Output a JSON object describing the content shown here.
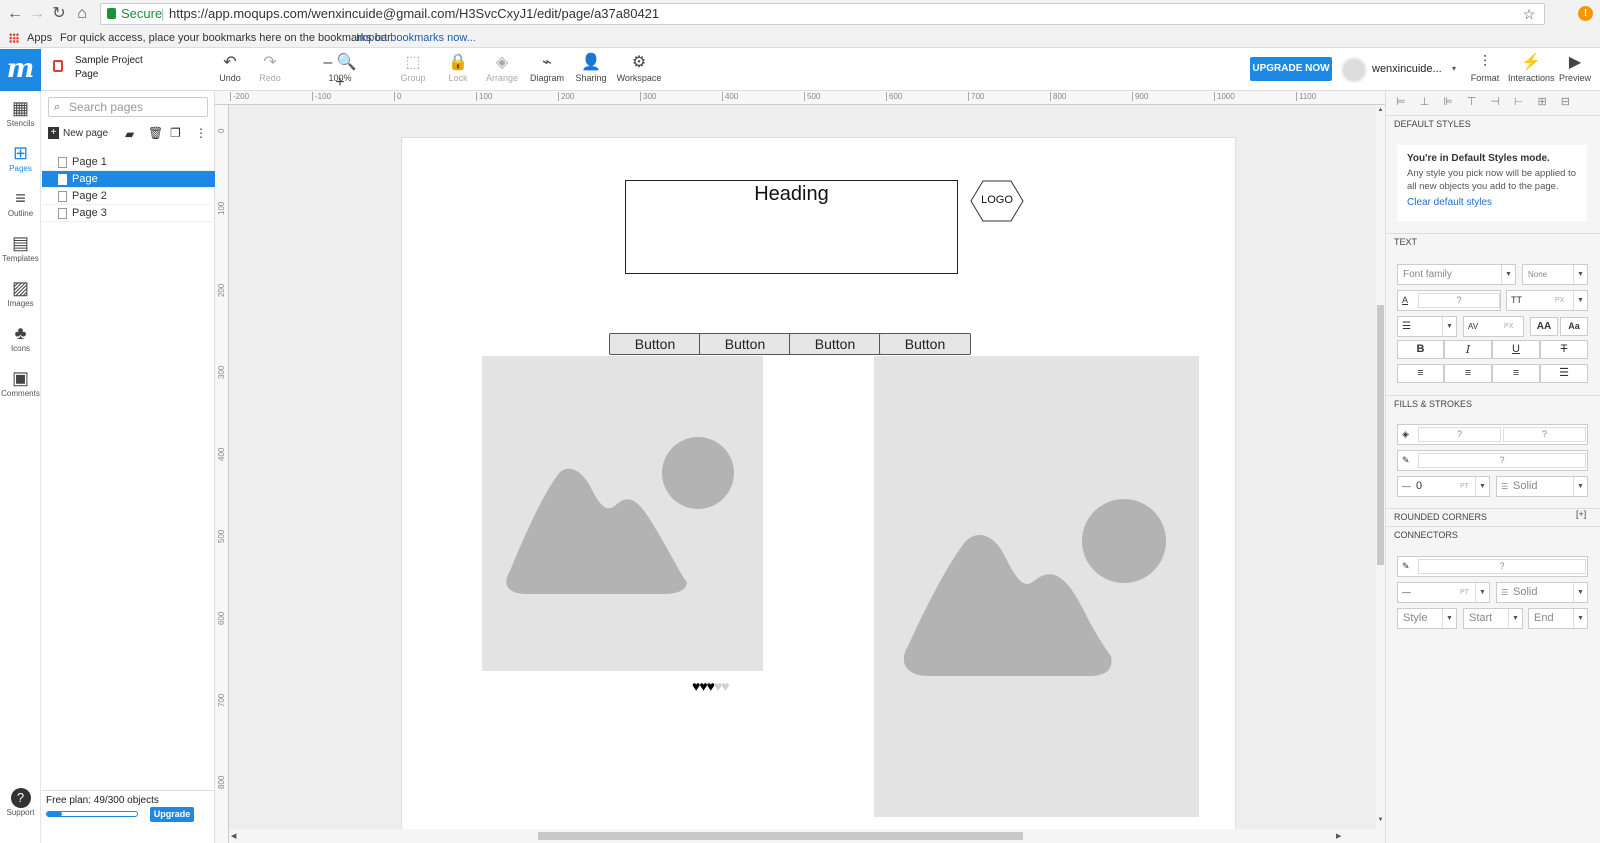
{
  "browser": {
    "secure_label": "Secure",
    "url": "https://app.moqups.com/wenxincuide@gmail.com/H3SvcCxyJ1/edit/page/a37a80421",
    "apps_label": "Apps",
    "bookmarks_hint": "For quick access, place your bookmarks here on the bookmarks bar.",
    "import_link": "Import bookmarks now..."
  },
  "app": {
    "logo": "m",
    "project_name": "Sample Project",
    "page_name": "Page",
    "zoom": "100%",
    "tools": [
      {
        "label": "Undo",
        "icon": "undo-icon",
        "glyph": "↶"
      },
      {
        "label": "Redo",
        "icon": "redo-icon",
        "glyph": "↷"
      },
      {
        "label": "Group",
        "icon": "group-icon",
        "glyph": "⬚"
      },
      {
        "label": "Lock",
        "icon": "lock-icon",
        "glyph": "🔒"
      },
      {
        "label": "Arrange",
        "icon": "arrange-icon",
        "glyph": "◈"
      },
      {
        "label": "Diagram",
        "icon": "diagram-icon",
        "glyph": "⌁"
      },
      {
        "label": "Sharing",
        "icon": "sharing-icon",
        "glyph": "👤"
      },
      {
        "label": "Workspace",
        "icon": "workspace-icon",
        "glyph": "⚙"
      }
    ],
    "upgrade_now": "UPGRADE NOW",
    "username": "wenxincuide...",
    "right_tools": [
      {
        "label": "Format",
        "icon": "format-icon",
        "glyph": "⫶"
      },
      {
        "label": "Interactions",
        "icon": "interactions-icon",
        "glyph": "⚡"
      },
      {
        "label": "Preview",
        "icon": "preview-icon",
        "glyph": "▶"
      }
    ]
  },
  "rail": [
    {
      "label": "Stencils",
      "icon": "stencils-icon",
      "glyph": "▦"
    },
    {
      "label": "Pages",
      "icon": "pages-icon",
      "glyph": "⊞"
    },
    {
      "label": "Outline",
      "icon": "outline-icon",
      "glyph": "≡"
    },
    {
      "label": "Templates",
      "icon": "templates-icon",
      "glyph": "▤"
    },
    {
      "label": "Images",
      "icon": "images-icon",
      "glyph": "▨"
    },
    {
      "label": "Icons",
      "icon": "icons-icon",
      "glyph": "♣"
    },
    {
      "label": "Comments",
      "icon": "comments-icon",
      "glyph": "▣"
    }
  ],
  "support_label": "Support",
  "pages_panel": {
    "search_placeholder": "Search pages",
    "new_page": "New page",
    "pages": [
      "Page 1",
      "Page",
      "Page 2",
      "Page 3"
    ],
    "selected_index": 1,
    "free_plan": "Free plan: 49/300 objects",
    "plan_usage": 0.163,
    "upgrade": "Upgrade"
  },
  "ruler": {
    "top": [
      "-200",
      "-100",
      "0",
      "100",
      "200",
      "300",
      "400",
      "500",
      "600",
      "700",
      "800",
      "900",
      "1000",
      "1100"
    ],
    "left": [
      "0",
      "100",
      "200",
      "300",
      "400",
      "500",
      "600",
      "700",
      "800"
    ]
  },
  "canvas": {
    "heading": "Heading",
    "logo": "LOGO",
    "buttons": [
      "Button",
      "Button",
      "Button",
      "Button"
    ],
    "rating": 3,
    "rating_max": 5
  },
  "right_panel": {
    "default_styles": "DEFAULT STYLES",
    "mode_title": "You're in Default Styles mode.",
    "mode_desc": "Any style you pick now will be applied to all new objects you add to the page.",
    "clear_link": "Clear default styles",
    "text": "TEXT",
    "font_family": "Font family",
    "none": "None",
    "q": "?",
    "px": "PX",
    "fills": "FILLS & STROKES",
    "zero": "0",
    "pt": "PT",
    "solid": "Solid",
    "rounded": "ROUNDED CORNERS",
    "plus": "[+]",
    "connectors": "CONNECTORS",
    "style": "Style",
    "start": "Start",
    "end": "End",
    "bold": "B",
    "italic": "I",
    "underline": "U",
    "strike": "T",
    "upper": "AA",
    "cap": "Aa"
  }
}
